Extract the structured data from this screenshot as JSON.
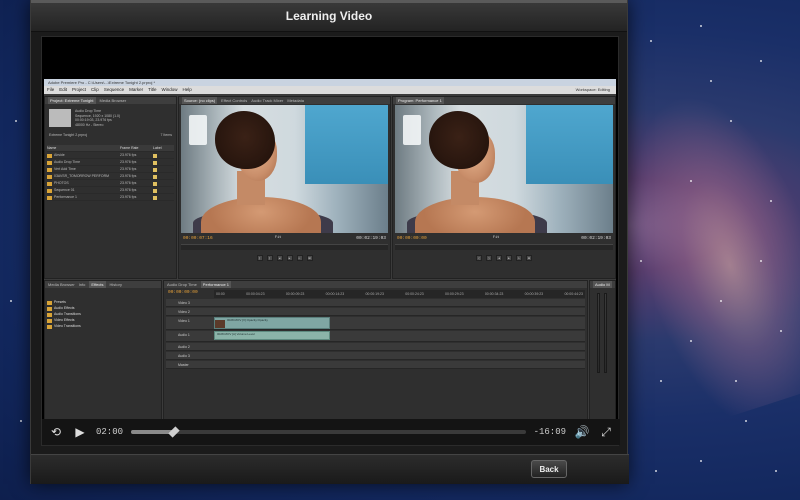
{
  "window": {
    "title": "Learning Video"
  },
  "player": {
    "current_time": "02:00",
    "remaining_time": "-16:09",
    "progress_percent": 11,
    "back_label": "Back"
  },
  "premiere": {
    "titlebar": "Adobe Premiere Pro - C:\\Users\\...\\Extreme Tonight 2.prproj *",
    "menu": [
      "File",
      "Edit",
      "Project",
      "Clip",
      "Sequence",
      "Marker",
      "Title",
      "Window",
      "Help"
    ],
    "workspace": "Workspace: Editing",
    "project_tabs": [
      "Project: Extreme Tonight",
      "Media Browser"
    ],
    "project_info": [
      "Audio Drop Time",
      "Sequence, 1920 x 1080 (1.0)",
      "00:00:19:03, 23.976 fps",
      "48000 Hz - Stereo"
    ],
    "project_name": "Extreme Tonight 2.prproj",
    "project_count": "7 Items",
    "project_columns": [
      "Name",
      "Frame Rate",
      "Label"
    ],
    "project_rows": [
      {
        "name": "Airside",
        "rate": "23.976 fps"
      },
      {
        "name": "Audio Drop Time",
        "rate": "23.976 fps"
      },
      {
        "name": "Vert Add Time",
        "rate": "23.976 fps"
      },
      {
        "name": "03AVSR_TOMORROW PERFORM",
        "rate": "23.976 fps"
      },
      {
        "name": "PHOTOS",
        "rate": "23.976 fps"
      },
      {
        "name": "Sequence 01",
        "rate": "23.976 fps"
      },
      {
        "name": "Performance 1",
        "rate": "23.976 fps"
      }
    ],
    "source_tabs": [
      "Source: (no clips)",
      "Effect Controls",
      "Audio Track Mixer",
      "Metadata"
    ],
    "program_tab": "Program: Performance 1",
    "source_tc_in": "00:00:07:16",
    "source_tc_out": "00:02:19:03",
    "source_fit": "Fit",
    "program_tc_in": "00:00:00:00",
    "program_tc_out": "00:02:19:03",
    "program_fit": "Fit",
    "effects_tabs": [
      "Media Browser",
      "Info",
      "Effects",
      "History"
    ],
    "effects_items": [
      "Presets",
      "Audio Effects",
      "Audio Transitions",
      "Video Effects",
      "Video Transitions"
    ],
    "timeline_tabs": [
      "Audio Drop Time",
      "Performance 1"
    ],
    "timeline_tc": "00:00:00:00",
    "timeline_ruler": [
      "00:00",
      "00:00:04:23",
      "00:00:09:23",
      "00:00:14:23",
      "00:00:19:23",
      "00:00:24:23",
      "00:00:29:23",
      "00:00:34:23",
      "00:00:39:23",
      "00:00:44:23"
    ],
    "tracks": [
      "Video 3",
      "Video 2",
      "Video 1",
      "Audio 1",
      "Audio 2",
      "Audio 3",
      "Master"
    ],
    "clip_v1": "0028.MOV [V] Opacity:Opacity",
    "clip_a1": "0028.MOV [A] Volume:Level",
    "audio_meter_tab": "Audio M"
  }
}
